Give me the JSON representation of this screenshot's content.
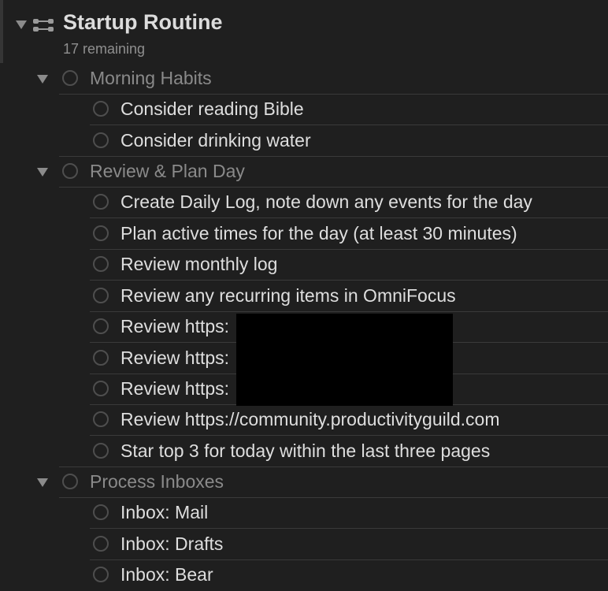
{
  "project": {
    "title": "Startup Routine",
    "remaining": "17 remaining"
  },
  "groups": [
    {
      "label": "Morning Habits",
      "tasks": [
        "Consider reading Bible",
        "Consider drinking water"
      ]
    },
    {
      "label": "Review & Plan Day",
      "tasks": [
        "Create Daily Log, note down any events for the day",
        "Plan active times for the day (at least 30 minutes)",
        "Review monthly log",
        "Review any recurring items in OmniFocus",
        "Review https:",
        "Review https:",
        "Review https:",
        "Review https://community.productivityguild.com",
        "Star top 3 for today within the last three pages"
      ]
    },
    {
      "label": "Process Inboxes",
      "tasks": [
        "Inbox: Mail",
        "Inbox: Drafts",
        "Inbox: Bear"
      ]
    }
  ],
  "colors": {
    "background": "#1f1f1f",
    "task_text": "#dedede",
    "group_text": "#8a8a8a",
    "separator": "#3a3a3a",
    "redaction": "#000000"
  }
}
